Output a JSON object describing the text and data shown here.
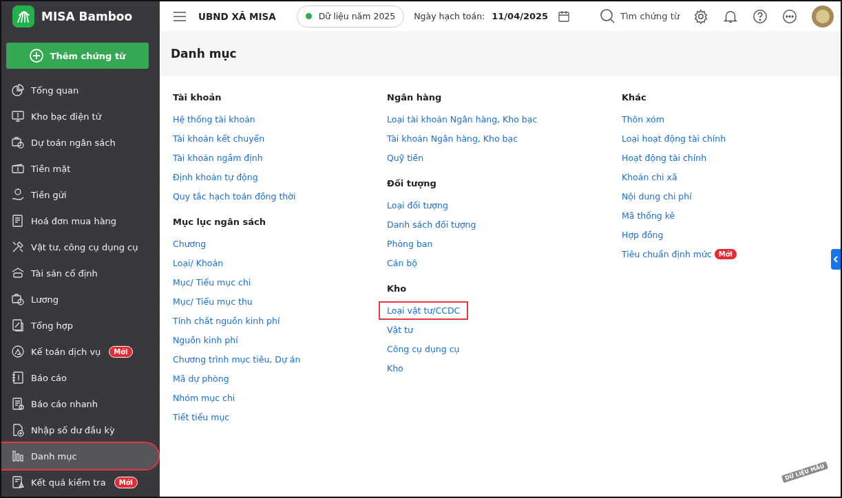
{
  "app": {
    "name": "MISA Bamboo",
    "add_button": "Thêm chứng từ"
  },
  "sidebar": {
    "items": [
      {
        "label": "Tổng quan",
        "selected": false,
        "highlighted": false
      },
      {
        "label": "Kho bạc điện tử",
        "selected": false,
        "highlighted": false
      },
      {
        "label": "Dự toán ngân sách",
        "selected": false,
        "highlighted": false
      },
      {
        "label": "Tiền mặt",
        "selected": false,
        "highlighted": false
      },
      {
        "label": "Tiền gửi",
        "selected": false,
        "highlighted": false
      },
      {
        "label": "Hoá đơn mua hàng",
        "selected": false,
        "highlighted": false
      },
      {
        "label": "Vật tư, công cụ dụng cụ",
        "selected": false,
        "highlighted": false
      },
      {
        "label": "Tài sản cố định",
        "selected": false,
        "highlighted": false
      },
      {
        "label": "Lương",
        "selected": false,
        "highlighted": false
      },
      {
        "label": "Tổng hợp",
        "selected": false,
        "highlighted": false
      },
      {
        "label": "Kế toán dịch vụ",
        "badge": "Mới",
        "selected": false,
        "highlighted": false
      },
      {
        "label": "Báo cáo",
        "selected": false,
        "highlighted": false
      },
      {
        "label": "Báo cáo nhanh",
        "selected": false,
        "highlighted": false
      },
      {
        "label": "Nhập số dư đầu kỳ",
        "selected": false,
        "highlighted": false
      },
      {
        "label": "Danh mục",
        "selected": true,
        "highlighted": true
      },
      {
        "label": "Kết quả kiểm tra",
        "badge": "Mới",
        "selected": false,
        "highlighted": false
      }
    ]
  },
  "topbar": {
    "org": "UBND XÃ MISA",
    "data_year": "Dữ liệu năm 2025",
    "date_label": "Ngày hạch toán:",
    "date": "11/04/2025",
    "search": "Tìm chứng từ"
  },
  "page": {
    "title": "Danh mục",
    "stamp": "DỮ LIỆU MẪU"
  },
  "columns": [
    [
      {
        "title": "Tài khoản",
        "items": [
          {
            "label": "Hệ thống tài khoản",
            "highlighted": false
          },
          {
            "label": "Tài khoản kết chuyển",
            "highlighted": false
          },
          {
            "label": "Tài khoản ngầm định",
            "highlighted": false
          },
          {
            "label": "Định khoản tự động",
            "highlighted": false
          },
          {
            "label": "Quy tắc hạch toán đồng thời",
            "highlighted": false
          }
        ]
      },
      {
        "title": "Mục lục ngân sách",
        "items": [
          {
            "label": "Chương",
            "highlighted": false
          },
          {
            "label": "Loại/ Khoản",
            "highlighted": false
          },
          {
            "label": "Mục/ Tiểu mục chi",
            "highlighted": false
          },
          {
            "label": "Mục/ Tiểu mục thu",
            "highlighted": false
          },
          {
            "label": "Tính chất nguồn kinh phí",
            "highlighted": false
          },
          {
            "label": "Nguồn kinh phí",
            "highlighted": false
          },
          {
            "label": "Chương trình mục tiêu, Dự án",
            "highlighted": false
          },
          {
            "label": "Mã dự phòng",
            "highlighted": false
          },
          {
            "label": "Nhóm mục chi",
            "highlighted": false
          },
          {
            "label": "Tiết tiểu mục",
            "highlighted": false
          }
        ]
      }
    ],
    [
      {
        "title": "Ngân hàng",
        "items": [
          {
            "label": "Loại tài khoản Ngân hàng, Kho bạc",
            "highlighted": false
          },
          {
            "label": "Tài khoản Ngân hàng, Kho bạc",
            "highlighted": false
          },
          {
            "label": "Quỹ tiền",
            "highlighted": false
          }
        ]
      },
      {
        "title": "Đối tượng",
        "items": [
          {
            "label": "Loại đối tượng",
            "highlighted": false
          },
          {
            "label": "Danh sách đối tượng",
            "highlighted": false
          },
          {
            "label": "Phòng ban",
            "highlighted": false
          },
          {
            "label": "Cán bộ",
            "highlighted": false
          }
        ]
      },
      {
        "title": "Kho",
        "items": [
          {
            "label": "Loại vật tư/CCDC",
            "highlighted": true
          },
          {
            "label": "Vật tư",
            "highlighted": false
          },
          {
            "label": "Công cụ dụng cụ",
            "highlighted": false
          },
          {
            "label": "Kho",
            "highlighted": false
          }
        ]
      }
    ],
    [
      {
        "title": "Khác",
        "items": [
          {
            "label": "Thôn xóm",
            "highlighted": false
          },
          {
            "label": "Loại hoạt động tài chính",
            "highlighted": false
          },
          {
            "label": "Hoạt động tài chính",
            "highlighted": false
          },
          {
            "label": "Khoản chi xã",
            "highlighted": false
          },
          {
            "label": "Nội dung chi phí",
            "highlighted": false
          },
          {
            "label": "Mã thống kê",
            "highlighted": false
          },
          {
            "label": "Hợp đồng",
            "highlighted": false
          },
          {
            "label": "Tiêu chuẩn định mức",
            "badge": "Mới",
            "highlighted": false
          }
        ]
      }
    ]
  ]
}
